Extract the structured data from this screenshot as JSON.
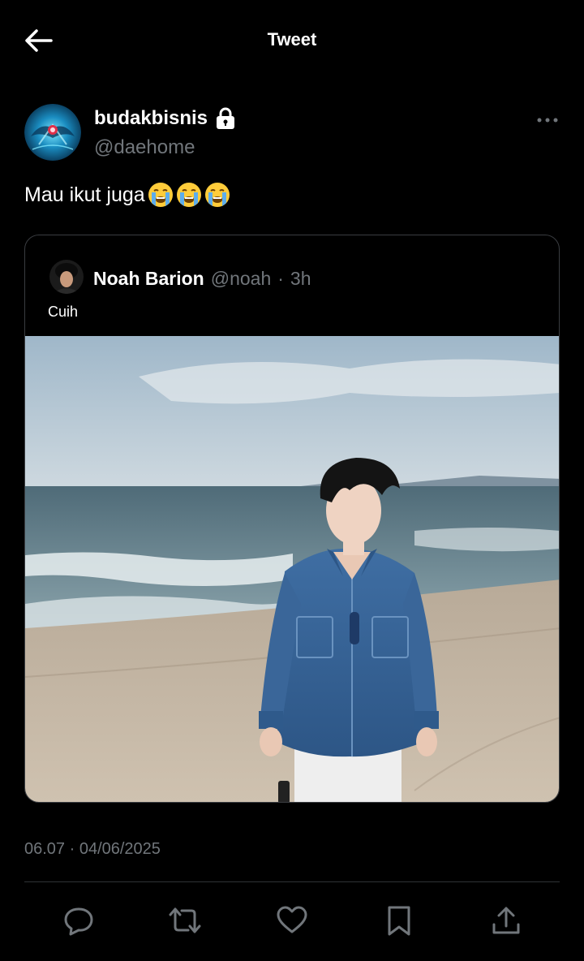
{
  "header": {
    "title": "Tweet",
    "back_icon": "arrow-left-icon"
  },
  "tweet": {
    "author": {
      "display_name": "budakbisnis",
      "handle": "@daehome",
      "locked": true
    },
    "text": "Mau ikut juga",
    "emoji": [
      "loudly-crying-face",
      "loudly-crying-face",
      "loudly-crying-face"
    ],
    "timestamp": "06.07 · 04/06/2025"
  },
  "quote": {
    "author": {
      "display_name": "Noah Barion",
      "handle": "@noah",
      "separator": "·",
      "time": "3h"
    },
    "text": "Cuih",
    "image_description": "beach-photo"
  },
  "actions": [
    {
      "name": "reply",
      "icon": "reply-icon"
    },
    {
      "name": "retweet",
      "icon": "retweet-icon"
    },
    {
      "name": "like",
      "icon": "heart-icon"
    },
    {
      "name": "bookmark",
      "icon": "bookmark-icon"
    },
    {
      "name": "share",
      "icon": "share-icon"
    }
  ],
  "colors": {
    "background": "#000000",
    "text": "#e7e9ea",
    "secondary": "#71767b",
    "border": "#3a3d41"
  }
}
